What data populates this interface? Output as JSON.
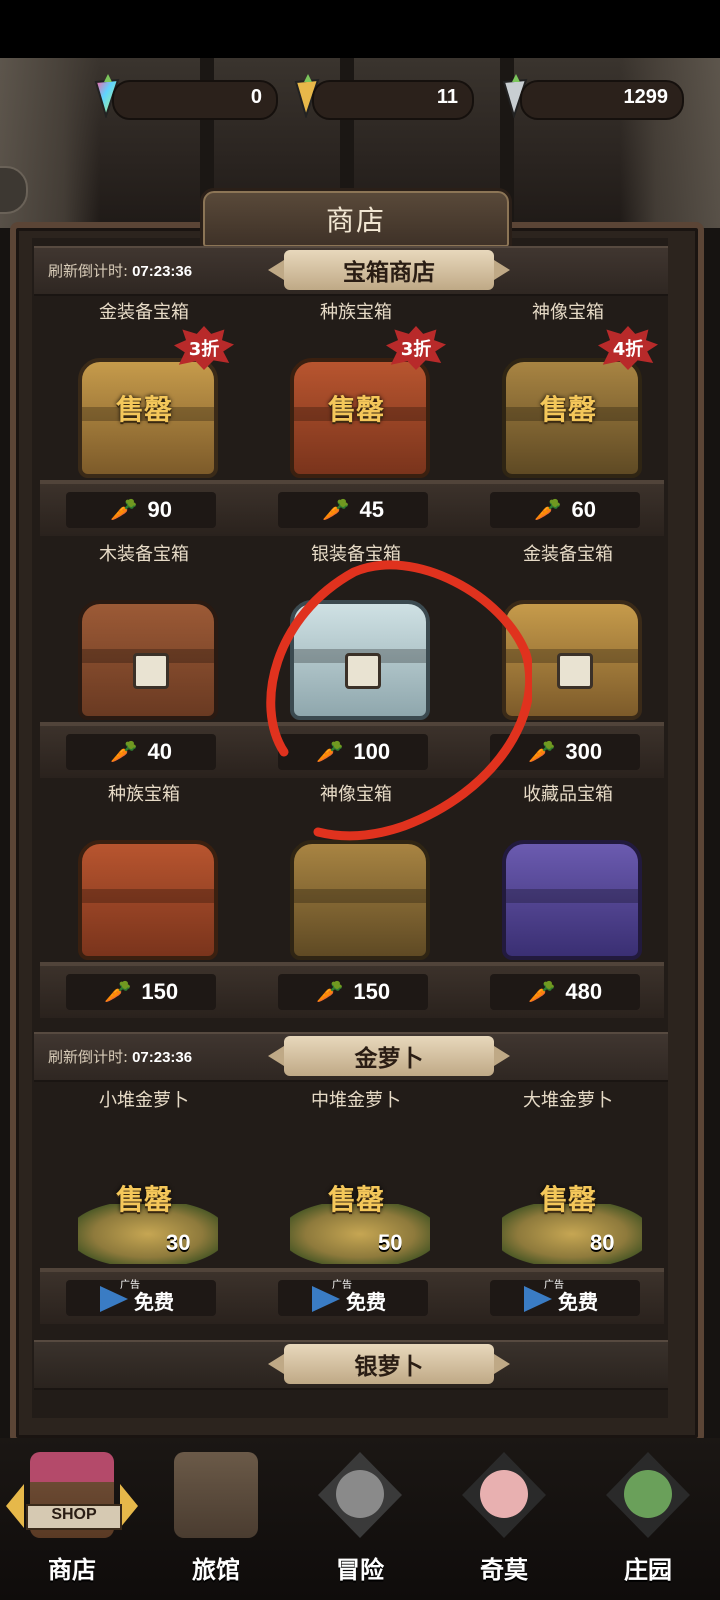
{
  "currency": {
    "rainbow_carrot": "0",
    "gold_carrot": "11",
    "silver_carrot": "1299"
  },
  "header": {
    "title": "商店"
  },
  "chest_shop": {
    "timer_label": "刷新倒计时:",
    "timer_value": "07:23:36",
    "title": "宝箱商店",
    "rows": [
      [
        {
          "name": "金装备宝箱",
          "price": "90",
          "sold": "售罄",
          "discount": "3折"
        },
        {
          "name": "种族宝箱",
          "price": "45",
          "sold": "售罄",
          "discount": "3折"
        },
        {
          "name": "神像宝箱",
          "price": "60",
          "sold": "售罄",
          "discount": "4折"
        }
      ],
      [
        {
          "name": "木装备宝箱",
          "price": "40"
        },
        {
          "name": "银装备宝箱",
          "price": "100"
        },
        {
          "name": "金装备宝箱",
          "price": "300"
        }
      ],
      [
        {
          "name": "种族宝箱",
          "price": "150"
        },
        {
          "name": "神像宝箱",
          "price": "150"
        },
        {
          "name": "收藏品宝箱",
          "price": "480"
        }
      ]
    ]
  },
  "gold_shop": {
    "timer_label": "刷新倒计时:",
    "timer_value": "07:23:36",
    "title": "金萝卜",
    "items": [
      {
        "name": "小堆金萝卜",
        "amount": "30",
        "sold": "售罄",
        "ad": "广告",
        "free": "免费"
      },
      {
        "name": "中堆金萝卜",
        "amount": "50",
        "sold": "售罄",
        "ad": "广告",
        "free": "免费"
      },
      {
        "name": "大堆金萝卜",
        "amount": "80",
        "sold": "售罄",
        "ad": "广告",
        "free": "免费"
      }
    ]
  },
  "silver_shop": {
    "title": "银萝卜"
  },
  "nav": [
    {
      "label": "商店",
      "icon": "shop-icon",
      "badge": "SHOP"
    },
    {
      "label": "旅馆",
      "icon": "inn-icon"
    },
    {
      "label": "冒险",
      "icon": "adventure-icon"
    },
    {
      "label": "奇莫",
      "icon": "qimo-icon"
    },
    {
      "label": "庄园",
      "icon": "manor-icon"
    }
  ],
  "colors": {
    "annotation": "#e0321e",
    "sold_text": "#f4c75a",
    "discount_bg": "#b82a2a"
  }
}
